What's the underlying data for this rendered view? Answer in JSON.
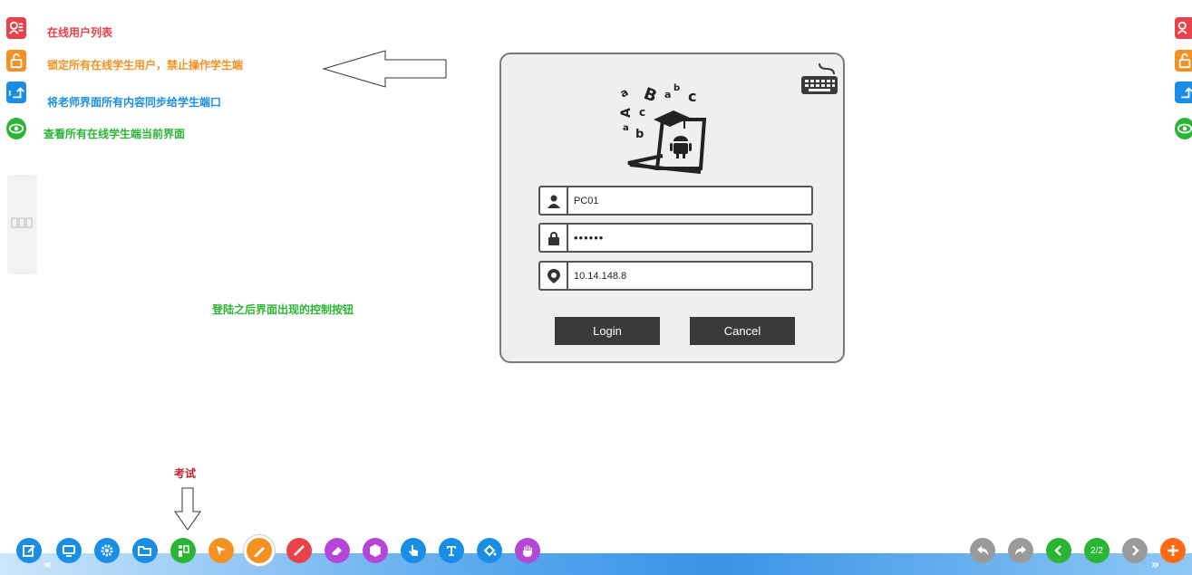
{
  "legend": {
    "items": [
      {
        "label": "在线用户列表",
        "color": "#e8424a"
      },
      {
        "label": "锁定所有在线学生用户，禁止操作学生端",
        "color": "#f39222"
      },
      {
        "label": "将老师界面所有内容同步给学生端口",
        "color": "#1a8ee6"
      },
      {
        "label": "查看所有在线学生端当前界面",
        "color": "#2bb534"
      }
    ]
  },
  "note_buttons": "登陆之后界面出现的控制按钮",
  "note_exam": "考试",
  "login": {
    "username": "PC01",
    "password": "••••••",
    "server_ip": "10.14.148.8",
    "login_label": "Login",
    "cancel_label": "Cancel"
  },
  "toolbar": {
    "page_indicator": "2/2",
    "left_chevron": "«",
    "right_chevron": "»"
  },
  "colors": {
    "red": "#e8424a",
    "orange": "#f39222",
    "blue": "#1a8ee6",
    "green": "#2bb534",
    "purple": "#b646d6",
    "gray": "#9a9a9a"
  }
}
